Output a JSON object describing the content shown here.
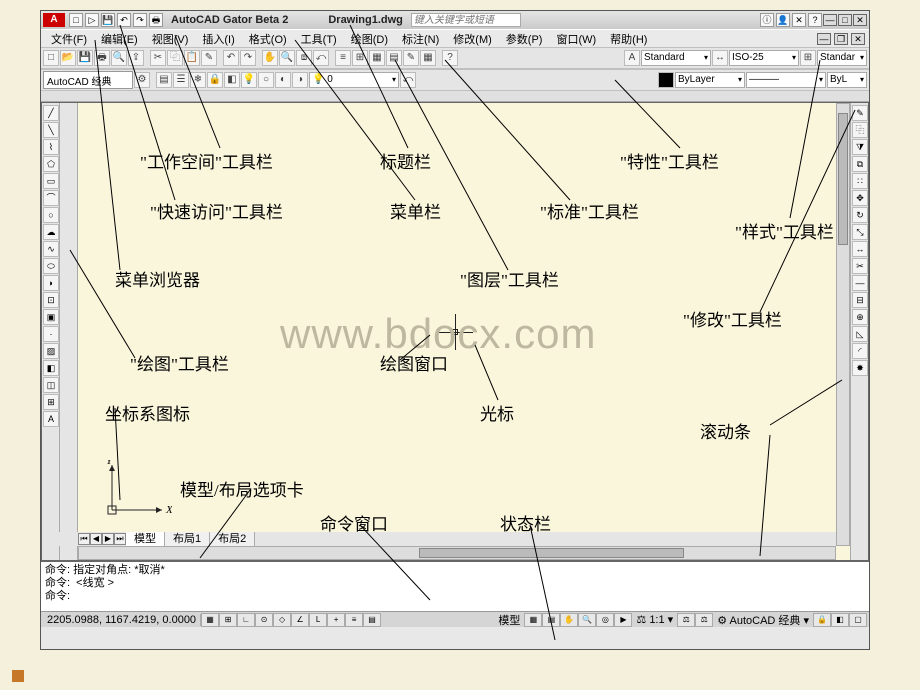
{
  "title": "AutoCAD Gator Beta 2",
  "document": "Drawing1.dwg",
  "search_placeholder": "键入关键字或短语",
  "menu": [
    "文件(F)",
    "编辑(E)",
    "视图(V)",
    "插入(I)",
    "格式(O)",
    "工具(T)",
    "绘图(D)",
    "标注(N)",
    "修改(M)",
    "参数(P)",
    "窗口(W)",
    "帮助(H)"
  ],
  "workspace": "AutoCAD 经典",
  "style_dropdowns": {
    "text": "Standard",
    "dim": "ISO-25",
    "table": "Standar"
  },
  "layer": {
    "bylayer1": "ByLayer",
    "bylayer2": "ByL"
  },
  "tabs": {
    "active": "模型",
    "others": [
      "布局1",
      "布局2"
    ]
  },
  "command": {
    "line1": "命令: 指定对角点: *取消*",
    "line2": "命令:  <线宽 >",
    "prompt": "命令:"
  },
  "status": {
    "coords": "2205.0988, 1167.4219, 0.0000",
    "model": "模型",
    "scale": "1:1",
    "ws": "AutoCAD 经典"
  },
  "annotations": {
    "workspace_tb": "\"工作空间\"工具栏",
    "title_bar": "标题栏",
    "properties_tb": "\"特性\"工具栏",
    "qat": "\"快速访问\"工具栏",
    "menu_bar": "菜单栏",
    "standard_tb": "\"标准\"工具栏",
    "styles_tb": "\"样式\"工具栏",
    "menu_browser": "菜单浏览器",
    "layers_tb": "\"图层\"工具栏",
    "modify_tb": "\"修改\"工具栏",
    "draw_tb": "\"绘图\"工具栏",
    "draw_window": "绘图窗口",
    "ucs": "坐标系图标",
    "tabs": "模型/布局选项卡",
    "cursor": "光标",
    "scrollbar": "滚动条",
    "cmd": "命令窗口",
    "status_bar": "状态栏"
  },
  "watermark": "www.bdocx.com",
  "ucs_labels": {
    "x": "X",
    "y": "Y"
  }
}
